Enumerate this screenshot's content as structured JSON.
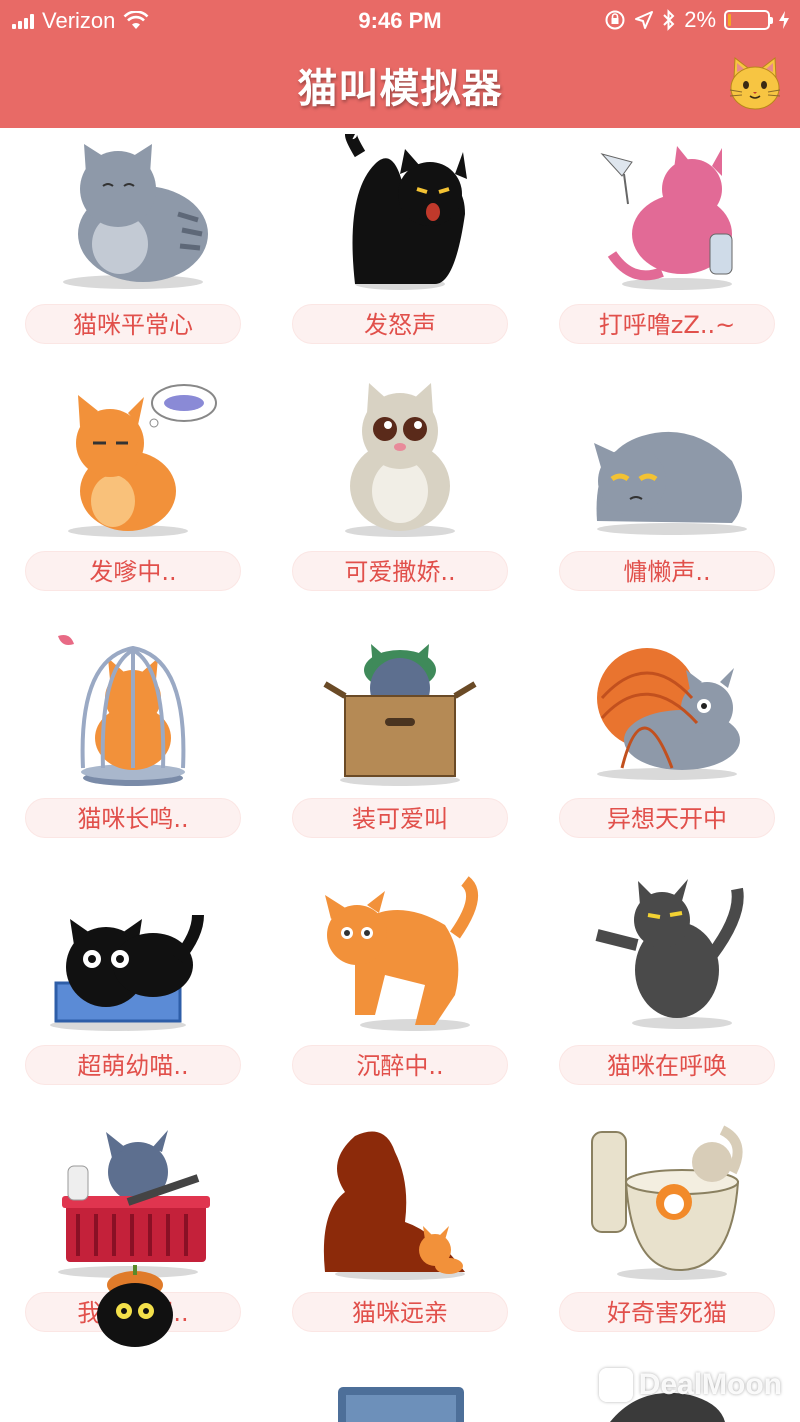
{
  "status_bar": {
    "carrier": "Verizon",
    "time": "9:46 PM",
    "battery_percent": "2%",
    "battery_level": 0.02,
    "icons": [
      "signal-icon",
      "wifi-icon",
      "orientation-lock-icon",
      "location-icon",
      "bluetooth-icon",
      "battery-icon",
      "charging-icon"
    ]
  },
  "header": {
    "title": "猫叫模拟器",
    "right_icon": "cat-face-emoji-icon"
  },
  "colors": {
    "header_bg": "#e86a66",
    "pill_bg": "#fdf1f0",
    "pill_text": "#e1504b"
  },
  "sounds": [
    {
      "label": "猫咪平常心",
      "icon": "gray-cat-icon"
    },
    {
      "label": "发怒声",
      "icon": "black-cat-angry-icon"
    },
    {
      "label": "打呼噜zZ..~",
      "icon": "pink-cat-drinking-icon"
    },
    {
      "label": "发嗲中..",
      "icon": "orange-cat-dreaming-icon"
    },
    {
      "label": "可爱撒娇..",
      "icon": "cream-cat-cute-icon"
    },
    {
      "label": "慵懒声..",
      "icon": "gray-cat-lying-icon"
    },
    {
      "label": "猫咪长鸣..",
      "icon": "cat-in-cage-icon"
    },
    {
      "label": "装可爱叫",
      "icon": "cat-in-box-icon"
    },
    {
      "label": "异想天开中",
      "icon": "cat-yarn-ball-icon"
    },
    {
      "label": "超萌幼喵..",
      "icon": "black-cat-litter-box-icon"
    },
    {
      "label": "沉醉中..",
      "icon": "orange-cat-stretching-icon"
    },
    {
      "label": "猫咪在呼唤",
      "icon": "dark-cat-reaching-icon"
    },
    {
      "label": "我是汤姆..",
      "icon": "cat-in-basket-icon"
    },
    {
      "label": "猫咪远亲",
      "icon": "lion-shadow-cat-icon"
    },
    {
      "label": "好奇害死猫",
      "icon": "cat-toilet-icon"
    }
  ],
  "watermark": "DealMoon"
}
